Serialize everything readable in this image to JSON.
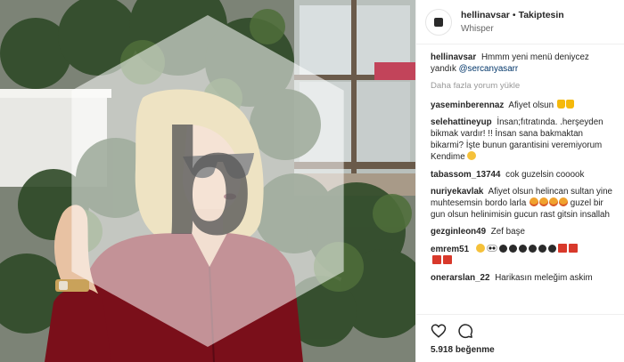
{
  "post": {
    "username": "hellinavsar",
    "separator": "•",
    "follow_label": "Takiptesin",
    "location": "Whisper"
  },
  "caption": {
    "user": "hellinavsar",
    "text": "Hmmm yeni menü deniycez yandık",
    "mention": "@sercanyasarr"
  },
  "load_more_label": "Daha fazla yorum yükle",
  "comments": [
    {
      "user": "yaseminberennaz",
      "text": "Afiyet olsun"
    },
    {
      "user": "selehattineyup",
      "text": "İnsan;fıtratında. .herşeyden bikmak vardır! !! İnsan sana bakmaktan bikarmi? İşte bunun garantisini veremiyorum Kendime"
    },
    {
      "user": "tabassom_13744",
      "text": "cok guzelsin cooook"
    },
    {
      "user": "nuriyekavlak",
      "text": "Afiyet olsun helincan sultan yine muhtesemsin bordo larla",
      "text2": "guzel bir gun olsun helinimisin gucun rast gitsin insallah"
    },
    {
      "user": "gezginleon49",
      "text": "Zef başe"
    },
    {
      "user": "emrem51",
      "text": ""
    },
    {
      "user": "onerarslan_22",
      "text": "Harikasın meleğim askim"
    }
  ],
  "likes": {
    "count": "5.918",
    "label": "beğenme"
  },
  "icons": {
    "heart": "heart-icon",
    "comment": "comment-icon",
    "watermark": "watermark-b-icon"
  },
  "colors": {
    "link": "#003569",
    "muted": "#999999",
    "dress": "#7a0f1a"
  }
}
